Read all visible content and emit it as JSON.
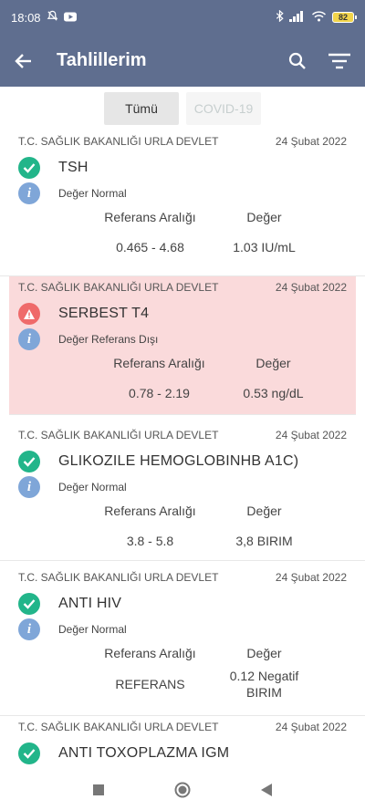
{
  "status_bar": {
    "time": "18:08",
    "battery": "82",
    "left_icons": [
      "mute-bell-icon",
      "youtube-icon"
    ],
    "right_icons": [
      "bluetooth-icon",
      "signal-icon",
      "wifi-icon",
      "battery-icon"
    ]
  },
  "app_bar": {
    "title": "Tahlillerim",
    "back_icon": "arrow-left-icon",
    "search_icon": "search-icon",
    "filter_icon": "filter-icon"
  },
  "tabs": [
    {
      "label": "Tümü",
      "active": true
    },
    {
      "label": "COVID-19",
      "active": false
    }
  ],
  "labels": {
    "reference_range": "Referans Aralığı",
    "value": "Değer"
  },
  "results": [
    {
      "hospital": "T.C. SAĞLIK BAKANLIĞI URLA DEVLET",
      "date": "24 Şubat 2022",
      "name": "TSH",
      "status": "normal",
      "note": "Değer Normal",
      "range": "0.465 - 4.68",
      "value": "1.03 IU/mL"
    },
    {
      "hospital": "T.C. SAĞLIK BAKANLIĞI URLA DEVLET",
      "date": "24 Şubat 2022",
      "name": "SERBEST T4",
      "status": "out_of_range",
      "note": "Değer Referans Dışı",
      "range": "0.78 - 2.19",
      "value": "0.53 ng/dL"
    },
    {
      "hospital": "T.C. SAĞLIK BAKANLIĞI URLA DEVLET",
      "date": "24 Şubat 2022",
      "name": "GLIKOZILE HEMOGLOBINHB A1C)",
      "status": "normal",
      "note": "Değer Normal",
      "range": "3.8 - 5.8",
      "value": "3,8 BIRIM"
    },
    {
      "hospital": "T.C. SAĞLIK BAKANLIĞI URLA DEVLET",
      "date": "24 Şubat 2022",
      "name": "ANTI HIV",
      "status": "normal",
      "note": "Değer Normal",
      "range": "REFERANS",
      "value": "0.12 Negatif BIRIM"
    },
    {
      "hospital": "T.C. SAĞLIK BAKANLIĞI URLA DEVLET",
      "date": "24 Şubat 2022",
      "name": "ANTI TOXOPLAZMA IGM"
    }
  ],
  "colors": {
    "app_bar": "#5f6e8f",
    "ok": "#22b58a",
    "warn": "#ef6a6a",
    "info": "#7fa6d8",
    "alert_bg": "#fadadb"
  }
}
